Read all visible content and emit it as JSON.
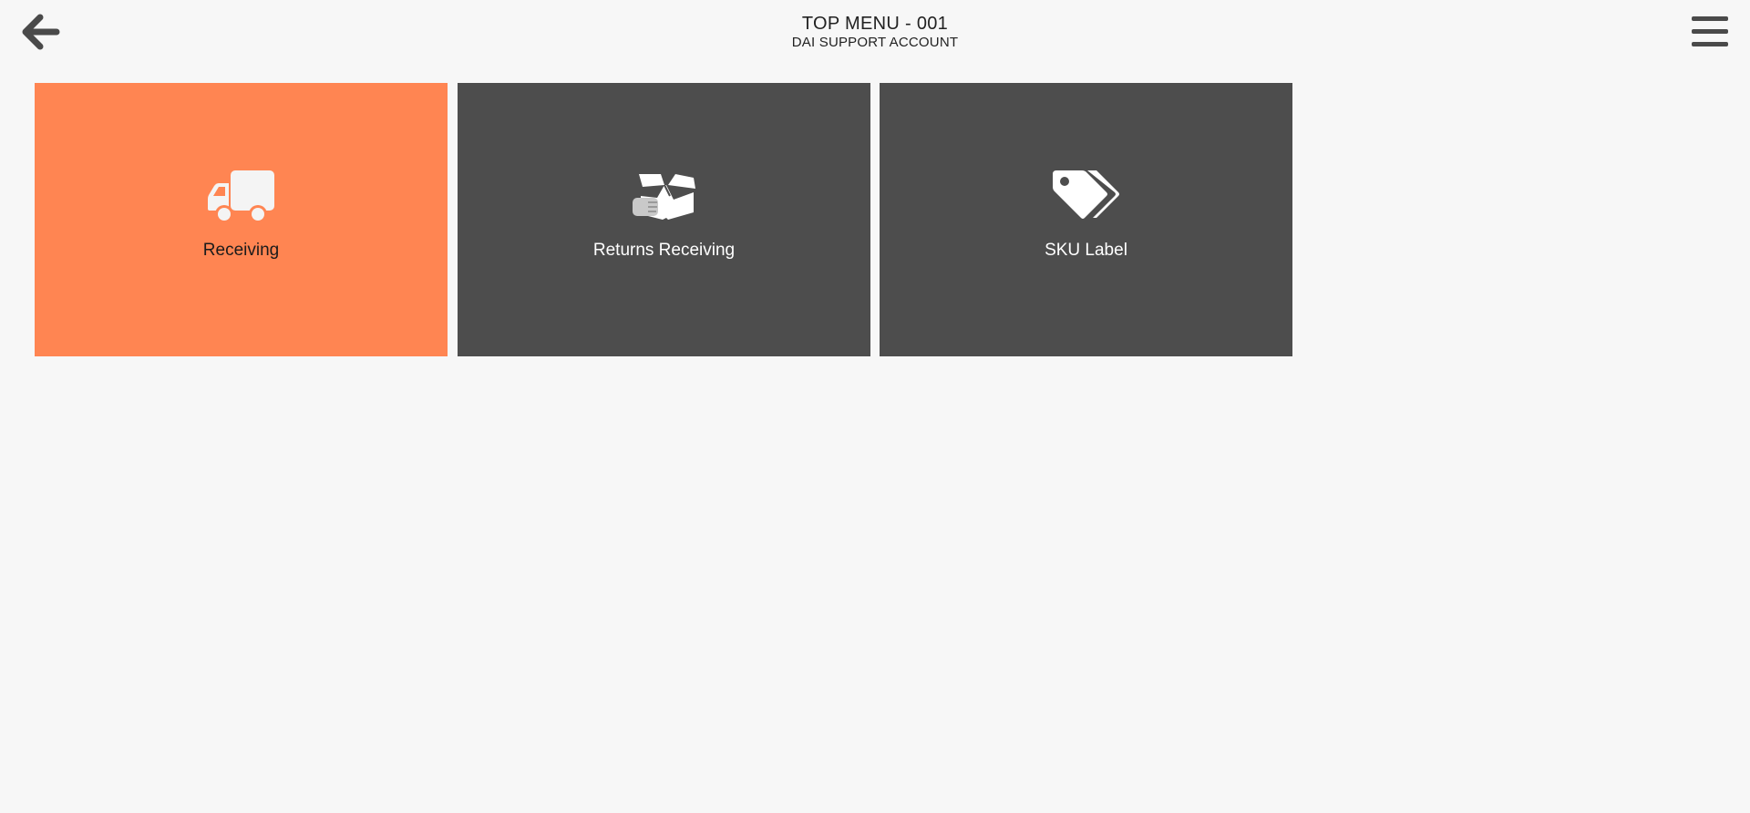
{
  "header": {
    "title": "TOP MENU - 001",
    "subtitle": "DAI SUPPORT ACCOUNT",
    "back_icon": "arrow-left-icon",
    "menu_icon": "hamburger-menu-icon"
  },
  "tiles": [
    {
      "label": "Receiving",
      "icon": "truck-icon",
      "color": "#ff8552",
      "selected": true
    },
    {
      "label": "Returns Receiving",
      "icon": "open-box-icon",
      "color": "#4d4d4d"
    },
    {
      "label": "SKU Label",
      "icon": "tags-icon",
      "color": "#4d4d4d"
    }
  ],
  "colors": {
    "background": "#f7f7f7",
    "accent": "#ff8552",
    "tile_dark": "#4d4d4d",
    "icon_dark": "#4a4a4a"
  }
}
